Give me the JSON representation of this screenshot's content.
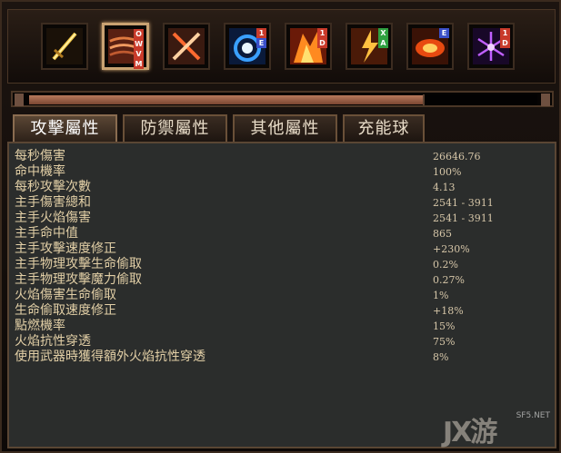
{
  "skills": [
    {
      "icon": "golden-sword-icon",
      "tags": []
    },
    {
      "icon": "flame-slash-icon",
      "tags": [
        {
          "text": "O",
          "color": "#c93a2a"
        },
        {
          "text": "W",
          "color": "#c93a2a"
        },
        {
          "text": "V",
          "color": "#c93a2a"
        },
        {
          "text": "M",
          "color": "#c93a2a"
        }
      ]
    },
    {
      "icon": "crossed-blades-icon",
      "tags": []
    },
    {
      "icon": "blue-vortex-icon",
      "tags": [
        {
          "text": "1",
          "color": "#c93a2a"
        },
        {
          "text": "E",
          "color": "#3a4fc9"
        }
      ]
    },
    {
      "icon": "fire-warrior-icon",
      "tags": [
        {
          "text": "1",
          "color": "#c93a2a"
        },
        {
          "text": "D",
          "color": "#c93a2a"
        }
      ]
    },
    {
      "icon": "lightning-warrior-icon",
      "tags": [
        {
          "text": "X",
          "color": "#2fa040"
        },
        {
          "text": "A",
          "color": "#2fa040"
        }
      ]
    },
    {
      "icon": "fire-runner-icon",
      "tags": [
        {
          "text": "E",
          "color": "#3a4fc9"
        }
      ]
    },
    {
      "icon": "purple-spark-icon",
      "tags": [
        {
          "text": "1",
          "color": "#c93a2a"
        },
        {
          "text": "D",
          "color": "#c93a2a"
        }
      ]
    }
  ],
  "progress": {
    "fraction": 0.78
  },
  "tabs": [
    "攻擊屬性",
    "防禦屬性",
    "其他屬性",
    "充能球"
  ],
  "active_tab": 0,
  "stats": [
    {
      "label": "每秒傷害",
      "value": "26646.76"
    },
    {
      "label": "命中機率",
      "value": "100%"
    },
    {
      "label": "每秒攻擊次數",
      "value": "4.13"
    },
    {
      "label": "主手傷害總和",
      "value": "2541 - 3911"
    },
    {
      "label": "主手火焰傷害",
      "value": "2541 - 3911"
    },
    {
      "label": "主手命中值",
      "value": "865"
    },
    {
      "label": "主手攻擊速度修正",
      "value": "+230%"
    },
    {
      "label": "主手物理攻擊生命偷取",
      "value": "0.2%"
    },
    {
      "label": "主手物理攻擊魔力偷取",
      "value": "0.27%"
    },
    {
      "label": "火焰傷害生命偷取",
      "value": "1%"
    },
    {
      "label": "生命偷取速度修正",
      "value": "+18%"
    },
    {
      "label": "點燃機率",
      "value": "15%"
    },
    {
      "label": "火焰抗性穿透",
      "value": "75%"
    },
    {
      "label": "使用武器時獲得額外火焰抗性穿透",
      "value": "8%"
    }
  ],
  "watermark": {
    "main": "JX游",
    "sub": "SF5.NET"
  }
}
